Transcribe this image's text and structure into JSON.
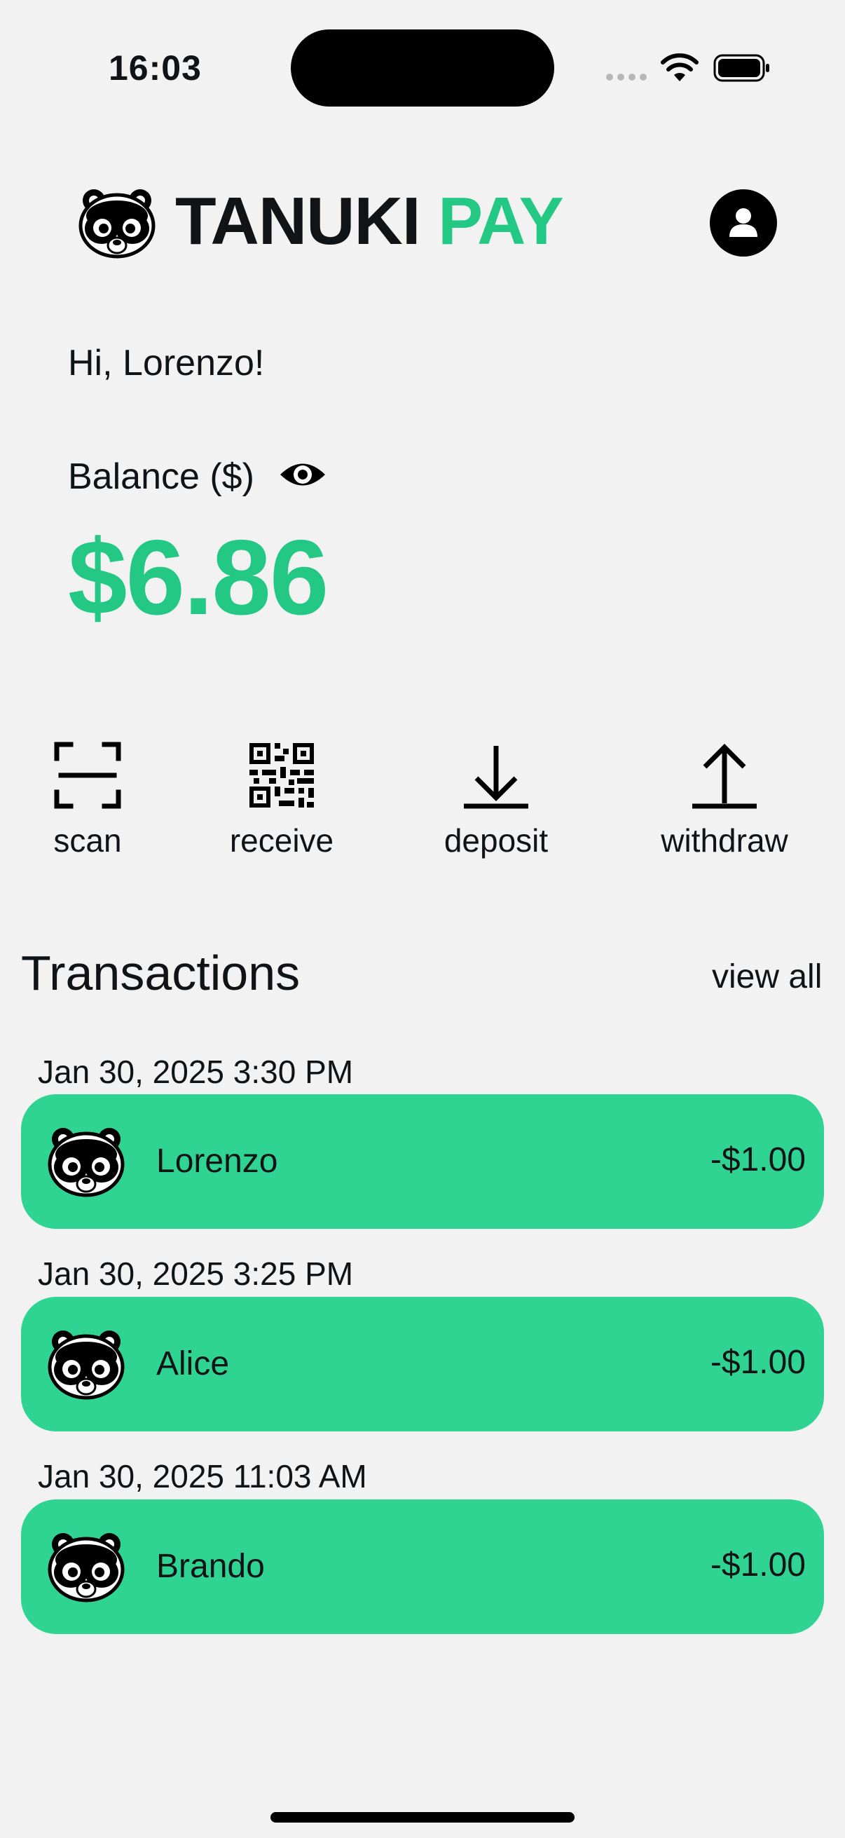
{
  "status_bar": {
    "time": "16:03"
  },
  "header": {
    "brand_part1": "TANUKI",
    "brand_part2": "PAY",
    "colors": {
      "brand_dark": "#111417",
      "accent": "#22c883"
    }
  },
  "greeting": "Hi, Lorenzo!",
  "balance": {
    "label": "Balance ($)",
    "amount": "$6.86"
  },
  "actions": [
    {
      "label": "scan",
      "icon": "scan-icon"
    },
    {
      "label": "receive",
      "icon": "qr-code-icon"
    },
    {
      "label": "deposit",
      "icon": "download-arrow-icon"
    },
    {
      "label": "withdraw",
      "icon": "upload-arrow-icon"
    }
  ],
  "transactions": {
    "title": "Transactions",
    "view_all": "view all",
    "items": [
      {
        "date": "Jan 30, 2025 3:30 PM",
        "name": "Lorenzo",
        "amount": "-$1.00"
      },
      {
        "date": "Jan 30, 2025 3:25 PM",
        "name": "Alice",
        "amount": "-$1.00"
      },
      {
        "date": "Jan 30, 2025 11:03 AM",
        "name": "Brando",
        "amount": "-$1.00"
      }
    ],
    "card_color": "#2fd492"
  }
}
